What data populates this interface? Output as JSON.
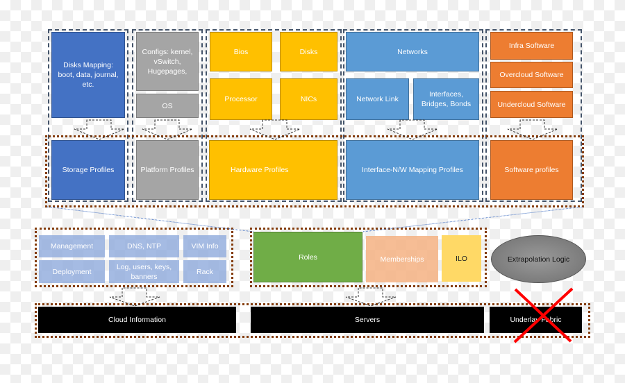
{
  "top": {
    "storage": {
      "source": "Disks Mapping: boot, data, journal, etc.",
      "profile": "Storage Profiles"
    },
    "platform": {
      "configs": "Configs: kernel, vSwitch, Hugepages,",
      "os": "OS",
      "profile": "Platform Profiles"
    },
    "hardware": {
      "bios": "Bios",
      "disks": "Disks",
      "processor": "Processor",
      "nics": "NICs",
      "profile": "Hardware Profiles"
    },
    "network": {
      "networks": "Networks",
      "link": "Network Link",
      "interfaces": "Interfaces, Bridges, Bonds",
      "profile": "Interface-N/W Mapping Profiles"
    },
    "software": {
      "infra": "Infra Software",
      "overcloud": "Overcloud Software",
      "undercloud": "Undercloud Software",
      "profile": "Software profiles"
    }
  },
  "cloud_info": {
    "management": "Management",
    "dns": "DNS, NTP",
    "vim": "VIM Info",
    "deployment": "Deployment",
    "log": "Log, users, keys, banners",
    "rack": "Rack"
  },
  "servers_group": {
    "roles": "Roles",
    "memberships": "Memberships",
    "ilo": "ILO"
  },
  "extrapolation": "Extrapolation Logic",
  "bottom": {
    "cloud": "Cloud Information",
    "servers": "Servers",
    "underlay": "Underlay Fabric"
  },
  "colors": {
    "storage": "#4472c4",
    "platform": "#a5a5a5",
    "hardware": "#ffc000",
    "network": "#5b9bd5",
    "software": "#ed7d31",
    "roles": "#70ad47",
    "memberships": "#f4b183",
    "ilo": "#ffd966",
    "cross_out": "#ff0000"
  }
}
